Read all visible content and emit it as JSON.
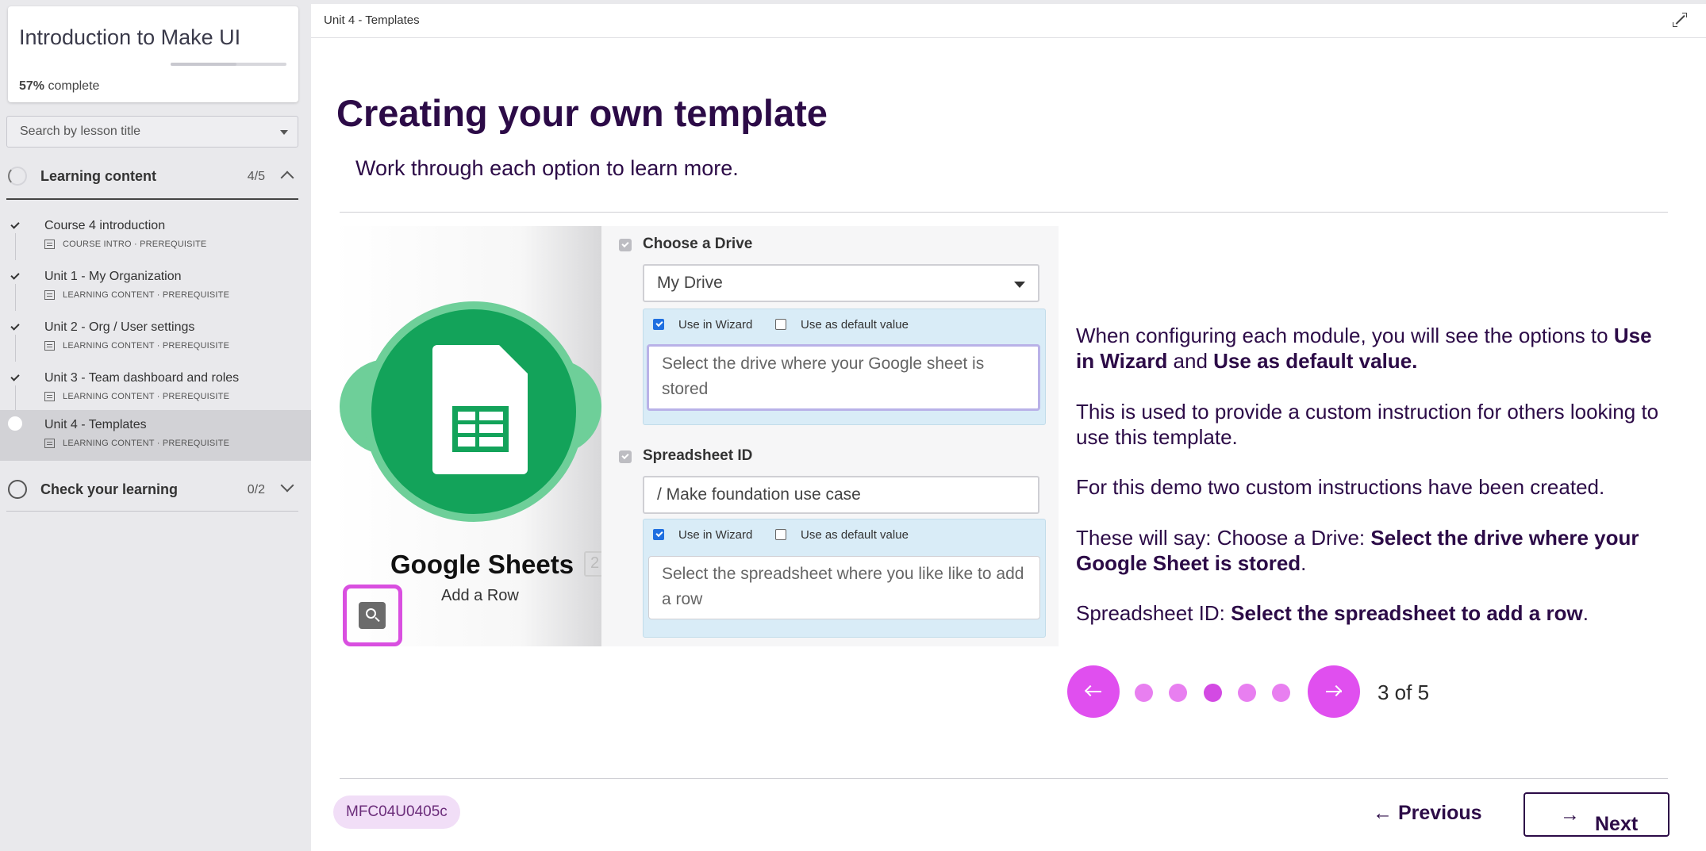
{
  "sidebar": {
    "course_title": "Introduction to Make UI",
    "progress_percent": 57,
    "progress_value": "57%",
    "progress_suffix": "complete",
    "search_placeholder": "Search by lesson title",
    "sections": [
      {
        "label": "Learning content",
        "count": "4/5",
        "expanded": true,
        "lessons": [
          {
            "title": "Course 4 introduction",
            "meta": "COURSE INTRO · PREREQUISITE",
            "status": "done"
          },
          {
            "title": "Unit 1 - My Organization",
            "meta": "LEARNING CONTENT · PREREQUISITE",
            "status": "done"
          },
          {
            "title": "Unit 2 - Org / User settings",
            "meta": "LEARNING CONTENT · PREREQUISITE",
            "status": "done"
          },
          {
            "title": "Unit 3 - Team dashboard and roles",
            "meta": "LEARNING CONTENT · PREREQUISITE",
            "status": "done"
          },
          {
            "title": "Unit 4 - Templates",
            "meta": "LEARNING CONTENT · PREREQUISITE",
            "status": "current"
          }
        ]
      },
      {
        "label": "Check your learning",
        "count": "0/2",
        "expanded": false
      }
    ]
  },
  "main": {
    "breadcrumb": "Unit 4 - Templates",
    "heading": "Creating your own template",
    "subheading": "Work through each option to learn more.",
    "illustration": {
      "app_name": "Google Sheets",
      "badge": "2",
      "action": "Add a Row",
      "field1": {
        "title": "Choose a Drive",
        "value": "My Drive",
        "use_in_wizard": "Use in Wizard",
        "use_as_default": "Use as default value",
        "instruction": "Select the drive where your Google sheet is stored"
      },
      "field2": {
        "title": "Spreadsheet ID",
        "value": "/ Make foundation use case",
        "use_in_wizard": "Use in Wizard",
        "use_as_default": "Use as default value",
        "instruction": "Select the spreadsheet where you like like to add a row"
      }
    },
    "description": {
      "p1_a": "When configuring each module, you will see the options to ",
      "p1_b": "Use in Wizard",
      "p1_c": " and ",
      "p1_d": "Use as default value.",
      "p2": "This is used to provide a custom instruction for others looking to use this template.",
      "p3": "For this demo two custom instructions have been created.",
      "p4_a": "These will say: Choose a Drive: ",
      "p4_b": "Select the drive where your Google Sheet is stored",
      "p4_c": ".",
      "p5_a": "Spreadsheet ID: ",
      "p5_b": "Select the spreadsheet to add a row",
      "p5_c": "."
    },
    "carousel": {
      "current": 3,
      "total": 5,
      "counter": "3 of 5"
    }
  },
  "footer": {
    "code": "MFC04U0405c",
    "previous_label": "Previous",
    "next_label": "Next"
  },
  "colors": {
    "accent": "#e04fef",
    "heading": "#2c0b47",
    "sheets_green": "#13a35a"
  }
}
